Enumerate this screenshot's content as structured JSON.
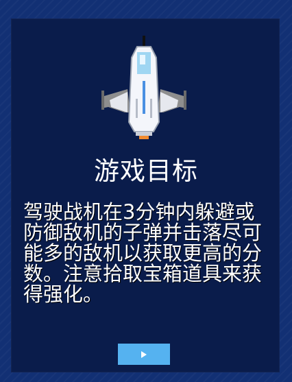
{
  "screen": {
    "title": "游戏目标",
    "description": "驾驶战机在3分钟内躲避或防御敌机的子弹并击落尽可能多的敌机以获取更高的分数。注意拾取宝箱道具来获得强化。"
  },
  "controls": {
    "start_icon": "play-icon"
  },
  "colors": {
    "background": "#123074",
    "panel": "#0a1c4b",
    "button": "#55b2f0",
    "text": "#ffffff"
  }
}
